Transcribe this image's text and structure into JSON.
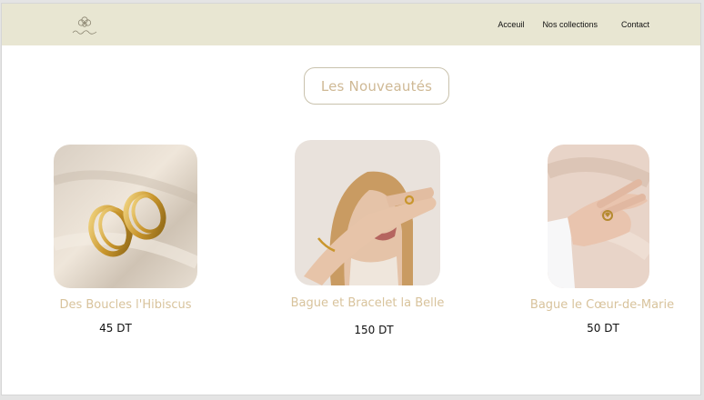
{
  "brand": {
    "logo_text": "Les Belles"
  },
  "nav": {
    "items": [
      {
        "label": "Acceuil"
      },
      {
        "label": "Nos collections"
      },
      {
        "label": "Contact"
      }
    ]
  },
  "section": {
    "title": "Les Nouveautés"
  },
  "products": [
    {
      "name": "Des Boucles l'Hibiscus",
      "price": "45 DT"
    },
    {
      "name": "Bague et Bracelet la Belle",
      "price": "150 DT"
    },
    {
      "name": "Bague le Cœur-de-Marie",
      "price": "50 DT"
    }
  ],
  "colors": {
    "navbar": "#e8e6d2",
    "accent_gold": "#d8c39c",
    "text": "#111111"
  }
}
